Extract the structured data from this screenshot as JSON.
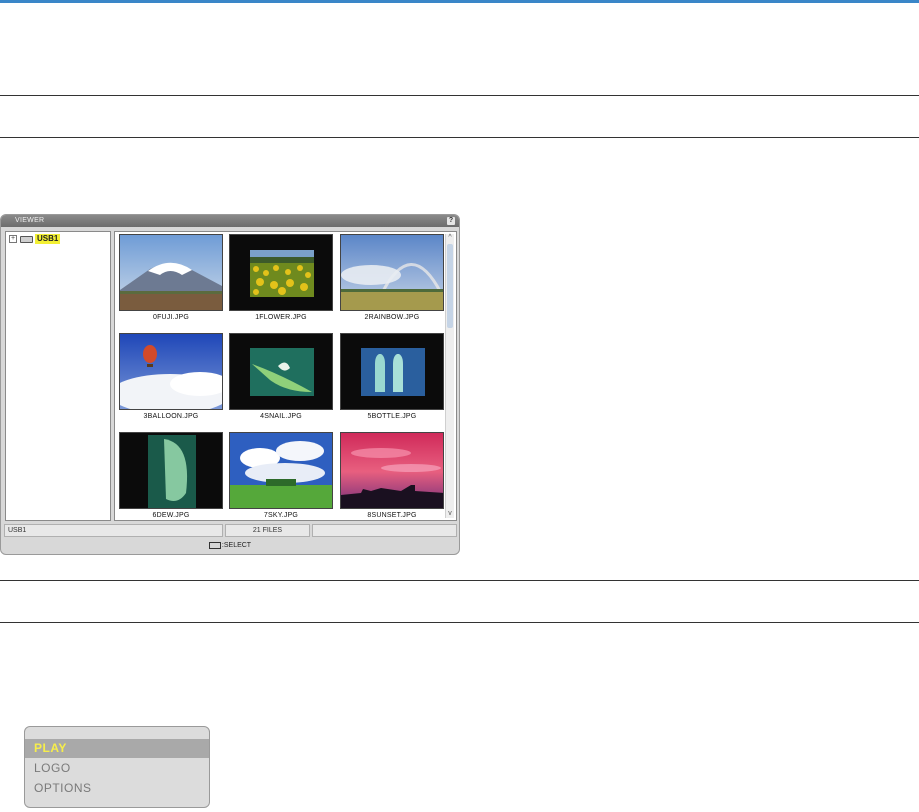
{
  "viewer": {
    "title": "VIEWER",
    "help_label": "?",
    "tree": {
      "expander": "+",
      "drive_label": "USB1"
    },
    "thumbnails": [
      {
        "label": "0FUJI.JPG",
        "scene": "fuji"
      },
      {
        "label": "1FLOWER.JPG",
        "scene": "flower"
      },
      {
        "label": "2RAINBOW.JPG",
        "scene": "rainbow"
      },
      {
        "label": "3BALLOON.JPG",
        "scene": "balloon"
      },
      {
        "label": "4SNAIL.JPG",
        "scene": "snail"
      },
      {
        "label": "5BOTTLE.JPG",
        "scene": "bottle"
      },
      {
        "label": "6DEW.JPG",
        "scene": "dew"
      },
      {
        "label": "7SKY.JPG",
        "scene": "sky"
      },
      {
        "label": "8SUNSET.JPG",
        "scene": "sunset"
      }
    ],
    "status": {
      "path": "USB1",
      "file_count": "21 FILES",
      "extra": ""
    },
    "footer_hint": ":SELECT",
    "scroll": {
      "up_icon": "^",
      "down_icon": "v"
    }
  },
  "menu": {
    "items": [
      {
        "label": "PLAY",
        "selected": true
      },
      {
        "label": "LOGO",
        "selected": false
      },
      {
        "label": "OPTIONS",
        "selected": false
      }
    ]
  },
  "colors": {
    "accent_rule": "#3a86c8",
    "selection_text": "#f7ee4a",
    "tree_highlight": "#f3f034"
  }
}
